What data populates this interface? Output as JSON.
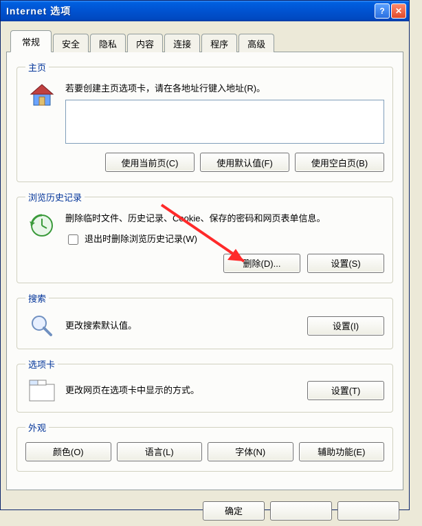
{
  "window": {
    "title": "Internet 选项"
  },
  "tabs": [
    "常规",
    "安全",
    "隐私",
    "内容",
    "连接",
    "程序",
    "高级"
  ],
  "active_tab": 0,
  "home": {
    "legend": "主页",
    "desc": "若要创建主页选项卡，请在各地址行键入地址(R)。",
    "textarea_value": "",
    "btn_current": "使用当前页(C)",
    "btn_default": "使用默认值(F)",
    "btn_blank": "使用空白页(B)"
  },
  "history": {
    "legend": "浏览历史记录",
    "desc": "删除临时文件、历史记录、Cookie、保存的密码和网页表单信息。",
    "checkbox": "退出时删除浏览历史记录(W)",
    "btn_delete": "删除(D)...",
    "btn_settings": "设置(S)"
  },
  "search": {
    "legend": "搜索",
    "desc": "更改搜索默认值。",
    "btn_settings": "设置(I)"
  },
  "tabs_section": {
    "legend": "选项卡",
    "desc": "更改网页在选项卡中显示的方式。",
    "btn_settings": "设置(T)"
  },
  "appearance": {
    "legend": "外观",
    "btn_color": "颜色(O)",
    "btn_lang": "语言(L)",
    "btn_font": "字体(N)",
    "btn_access": "辅助功能(E)"
  },
  "dialog_buttons": {
    "ok": "确定",
    "cancel": "",
    "apply": ""
  }
}
